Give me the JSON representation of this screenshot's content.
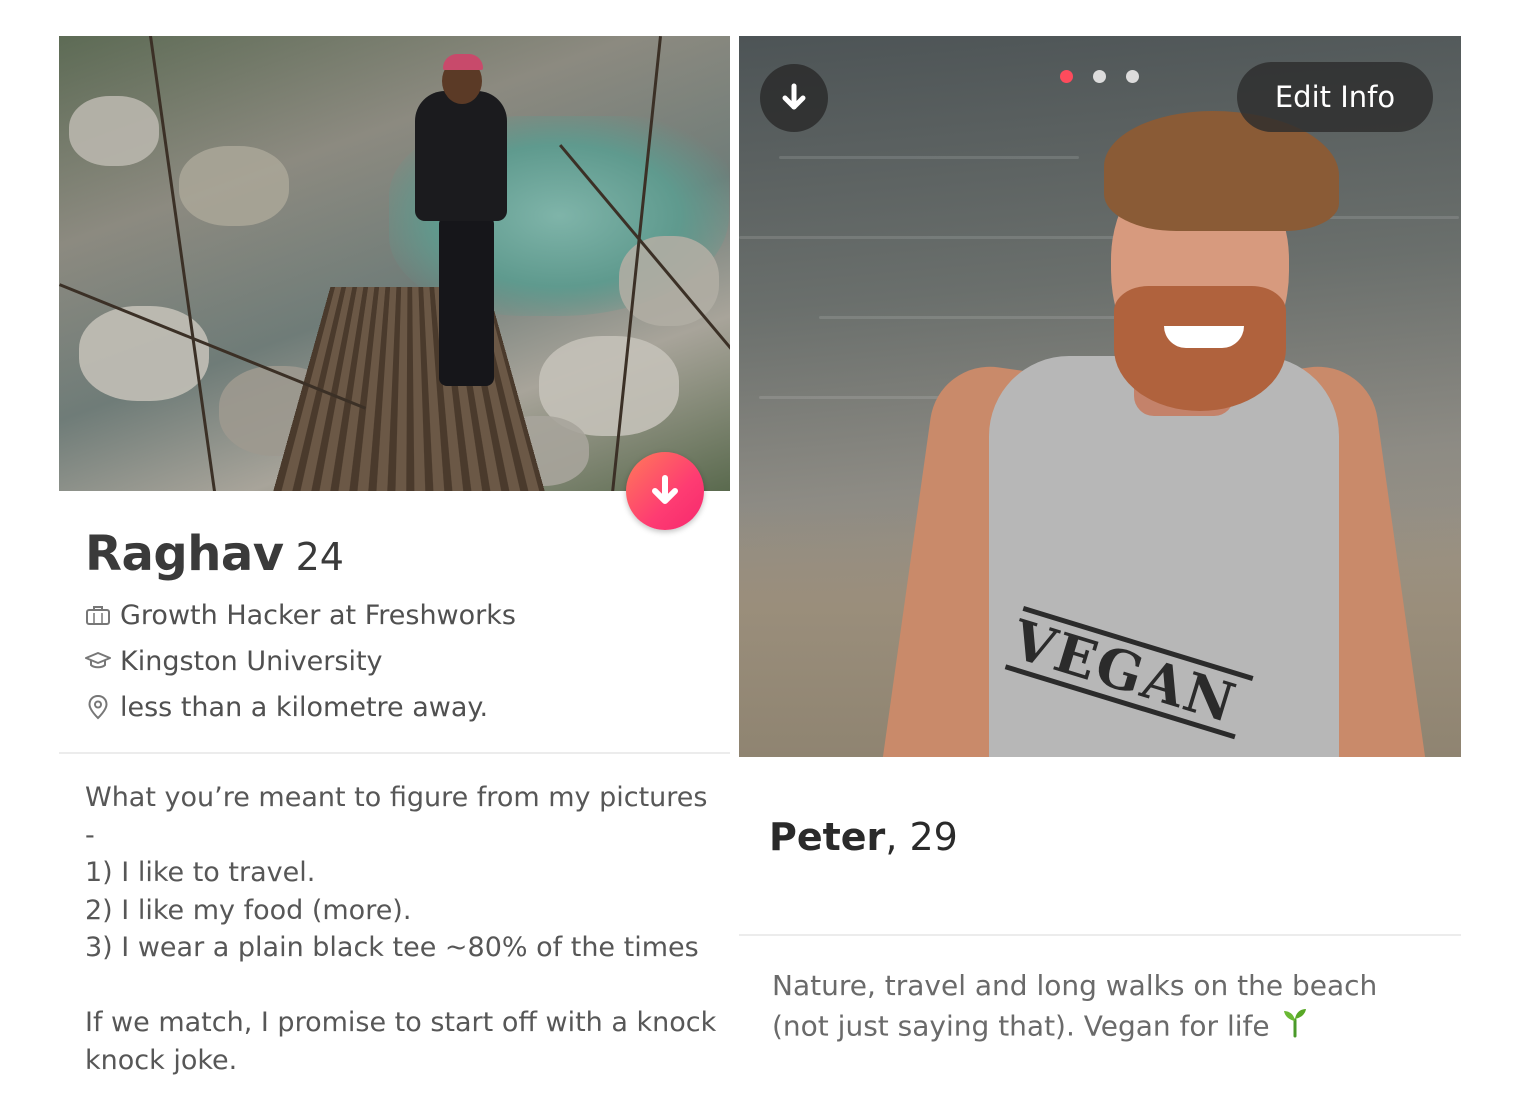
{
  "left_profile": {
    "name": "Raghav",
    "age": "24",
    "job": "Growth Hacker at Freshworks",
    "school": "Kingston University",
    "distance": "less than a kilometre away.",
    "bio_lines": [
      "What you’re meant to figure from my pictures",
      "-",
      "1) I like to travel.",
      "2) I like my food (more).",
      "3) I wear a plain black tee ~80% of the times",
      "",
      "If we match, I promise to start off with a knock",
      "knock joke."
    ],
    "icons": {
      "job": "briefcase-icon",
      "school": "graduation-cap-icon",
      "distance": "location-pin-icon",
      "download": "arrow-down-icon"
    },
    "accent_color": "#fe3c72"
  },
  "right_profile": {
    "name": "Peter",
    "name_separator": ",",
    "age": "29",
    "edit_button": "Edit Info",
    "photo_count": 3,
    "active_photo_index": 0,
    "shirt_print": "VEGAN",
    "bio_lines": [
      "Nature, travel and long walks on the beach",
      "(not just saying that). Vegan for life"
    ],
    "bio_emoji": "seedling-icon",
    "dot_active_color": "#fe4b5c"
  }
}
